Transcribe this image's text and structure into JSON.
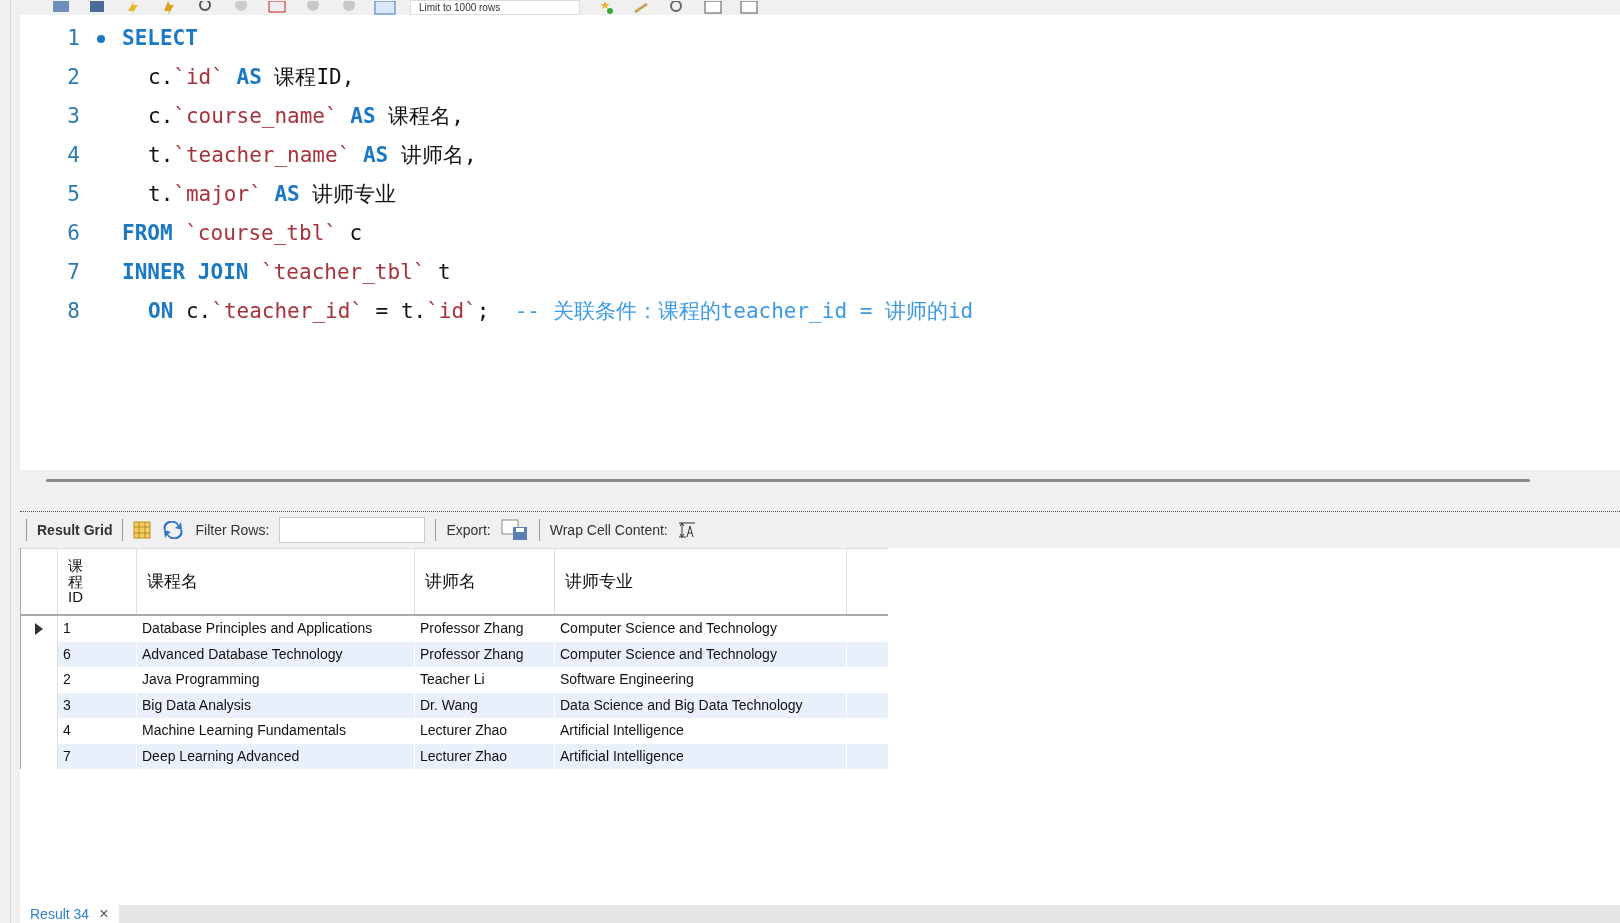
{
  "toolbar": {
    "limit": "Limit to 1000 rows"
  },
  "editor": {
    "lines": [
      {
        "number": "1",
        "marker": true,
        "indent": false,
        "tokens": [
          {
            "kind": "keyword",
            "text": "SELECT"
          }
        ]
      },
      {
        "number": "2",
        "marker": false,
        "indent": true,
        "tokens": [
          {
            "kind": "plain",
            "text": "c."
          },
          {
            "kind": "ident",
            "text": "`id`"
          },
          {
            "kind": "keyword",
            "text": " AS "
          },
          {
            "kind": "plain",
            "text": "课程ID,"
          }
        ]
      },
      {
        "number": "3",
        "marker": false,
        "indent": true,
        "tokens": [
          {
            "kind": "plain",
            "text": "c."
          },
          {
            "kind": "ident",
            "text": "`course_name`"
          },
          {
            "kind": "keyword",
            "text": " AS "
          },
          {
            "kind": "plain",
            "text": "课程名,"
          }
        ]
      },
      {
        "number": "4",
        "marker": false,
        "indent": true,
        "tokens": [
          {
            "kind": "plain",
            "text": "t."
          },
          {
            "kind": "ident",
            "text": "`teacher_name`"
          },
          {
            "kind": "keyword",
            "text": " AS "
          },
          {
            "kind": "plain",
            "text": "讲师名,"
          }
        ]
      },
      {
        "number": "5",
        "marker": false,
        "indent": true,
        "tokens": [
          {
            "kind": "plain",
            "text": "t."
          },
          {
            "kind": "ident",
            "text": "`major`"
          },
          {
            "kind": "keyword",
            "text": " AS "
          },
          {
            "kind": "plain",
            "text": "讲师专业"
          }
        ]
      },
      {
        "number": "6",
        "marker": false,
        "indent": false,
        "tokens": [
          {
            "kind": "keyword",
            "text": "FROM "
          },
          {
            "kind": "ident",
            "text": "`course_tbl`"
          },
          {
            "kind": "plain",
            "text": " c"
          }
        ]
      },
      {
        "number": "7",
        "marker": false,
        "indent": false,
        "tokens": [
          {
            "kind": "keyword",
            "text": "INNER JOIN "
          },
          {
            "kind": "ident",
            "text": "`teacher_tbl`"
          },
          {
            "kind": "plain",
            "text": " t"
          }
        ]
      },
      {
        "number": "8",
        "marker": false,
        "indent": true,
        "tokens": [
          {
            "kind": "keyword",
            "text": "ON "
          },
          {
            "kind": "plain",
            "text": "c."
          },
          {
            "kind": "ident",
            "text": "`teacher_id`"
          },
          {
            "kind": "plain",
            "text": " = t."
          },
          {
            "kind": "ident",
            "text": "`id`"
          },
          {
            "kind": "plain",
            "text": ";  "
          },
          {
            "kind": "comment",
            "text": "-- 关联条件：课程的teacher_id = 讲师的id"
          }
        ]
      }
    ]
  },
  "results_toolbar": {
    "title": "Result Grid",
    "filter_label": "Filter Rows:",
    "export_label": "Export:",
    "wrap_label": "Wrap Cell Content:"
  },
  "table": {
    "columns": [
      "课程ID",
      "课程名",
      "讲师名",
      "讲师专业"
    ],
    "rows": [
      {
        "selected": true,
        "cells": [
          "1",
          "Database Principles and Applications",
          "Professor Zhang",
          "Computer Science and Technology"
        ]
      },
      {
        "selected": false,
        "cells": [
          "6",
          "Advanced Database Technology",
          "Professor Zhang",
          "Computer Science and Technology"
        ]
      },
      {
        "selected": false,
        "cells": [
          "2",
          "Java Programming",
          "Teacher Li",
          "Software Engineering"
        ]
      },
      {
        "selected": false,
        "cells": [
          "3",
          "Big Data Analysis",
          "Dr. Wang",
          "Data Science and Big Data Technology"
        ]
      },
      {
        "selected": false,
        "cells": [
          "4",
          "Machine Learning Fundamentals",
          "Lecturer Zhao",
          "Artificial Intelligence"
        ]
      },
      {
        "selected": false,
        "cells": [
          "7",
          "Deep Learning Advanced",
          "Lecturer Zhao",
          "Artificial Intelligence"
        ]
      }
    ]
  },
  "result_tab": {
    "label": "Result 34",
    "close": "×"
  }
}
